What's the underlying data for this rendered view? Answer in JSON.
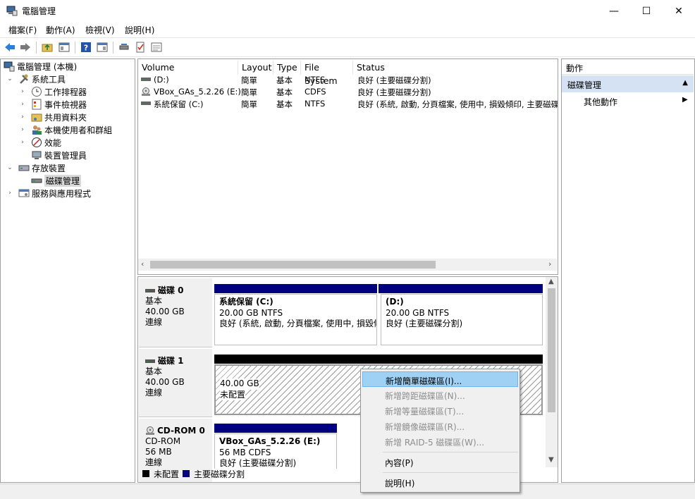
{
  "window": {
    "title": "電腦管理",
    "minimize": "—",
    "maximize": "☐",
    "close": "✕"
  },
  "menu": [
    "檔案(F)",
    "動作(A)",
    "檢視(V)",
    "說明(H)"
  ],
  "tree": [
    {
      "label": "電腦管理 (本機)",
      "icon": "computer-management-icon",
      "level": 0,
      "arrow": ""
    },
    {
      "label": "系統工具",
      "icon": "system-tools-icon",
      "level": 1,
      "arrow": "⌄"
    },
    {
      "label": "工作排程器",
      "icon": "task-scheduler-icon",
      "level": 2,
      "arrow": "›"
    },
    {
      "label": "事件檢視器",
      "icon": "event-viewer-icon",
      "level": 2,
      "arrow": "›"
    },
    {
      "label": "共用資料夾",
      "icon": "shared-folders-icon",
      "level": 2,
      "arrow": "›"
    },
    {
      "label": "本機使用者和群組",
      "icon": "users-groups-icon",
      "level": 2,
      "arrow": "›"
    },
    {
      "label": "效能",
      "icon": "performance-icon",
      "level": 2,
      "arrow": "›"
    },
    {
      "label": "裝置管理員",
      "icon": "device-manager-icon",
      "level": 2,
      "arrow": ""
    },
    {
      "label": "存放裝置",
      "icon": "storage-icon",
      "level": 1,
      "arrow": "⌄"
    },
    {
      "label": "磁碟管理",
      "icon": "disk-management-icon",
      "level": 2,
      "arrow": "",
      "selected": true
    },
    {
      "label": "服務與應用程式",
      "icon": "services-apps-icon",
      "level": 1,
      "arrow": "›"
    }
  ],
  "columns": [
    "Volume",
    "Layout",
    "Type",
    "File System",
    "Status"
  ],
  "volumes": [
    {
      "volume": "(D:)",
      "layout": "簡單",
      "type": "基本",
      "fs": "NTFS",
      "status": "良好 (主要磁碟分割)"
    },
    {
      "volume": "VBox_GAs_5.2.26 (E:)",
      "layout": "簡單",
      "type": "基本",
      "fs": "CDFS",
      "status": "良好 (主要磁碟分割)"
    },
    {
      "volume": "系統保留 (C:)",
      "layout": "簡單",
      "type": "基本",
      "fs": "NTFS",
      "status": "良好 (系統, 啟動, 分頁檔案, 使用中, 損毀傾印, 主要磁碟"
    }
  ],
  "disks": {
    "disk0": {
      "name": "磁碟 0",
      "type": "基本",
      "size": "40.00 GB",
      "state": "連線"
    },
    "disk1": {
      "name": "磁碟 1",
      "type": "基本",
      "size": "40.00 GB",
      "state": "連線"
    },
    "cdrom0": {
      "name": "CD-ROM 0",
      "type": "CD-ROM",
      "size": "56 MB",
      "state": "連線"
    }
  },
  "partitions": {
    "c": {
      "name": "系統保留  (C:)",
      "size": "20.00 GB NTFS",
      "status": "良好 (系統, 啟動, 分頁檔案, 使用中, 損毀傾"
    },
    "d": {
      "name": "(D:)",
      "size": "20.00 GB NTFS",
      "status": "良好 (主要磁碟分割)"
    },
    "unalloc": {
      "size": "40.00 GB",
      "status": "未配置"
    },
    "e": {
      "name": "VBox_GAs_5.2.26  (E:)",
      "size": "56 MB CDFS",
      "status": "良好 (主要磁碟分割)"
    }
  },
  "legend": {
    "unallocated": "未配置",
    "primary": "主要磁碟分割"
  },
  "actions": {
    "header": "動作",
    "section": "磁碟管理",
    "more": "其他動作"
  },
  "context_menu": {
    "items": [
      {
        "label": "新增簡單磁碟區(I)...",
        "enabled": true,
        "highlighted": true
      },
      {
        "label": "新增跨距磁碟區(N)...",
        "enabled": false
      },
      {
        "label": "新增等量磁碟區(T)...",
        "enabled": false
      },
      {
        "label": "新增鏡像磁碟區(R)...",
        "enabled": false
      },
      {
        "label": "新增 RAID-5 磁碟區(W)...",
        "enabled": false
      }
    ],
    "properties": "內容(P)",
    "help": "說明(H)"
  },
  "colors": {
    "primary_partition": "#00007f",
    "unallocated": "#000000",
    "selection": "#d4e2f4",
    "ctx_highlight": "#9fd1f5"
  }
}
